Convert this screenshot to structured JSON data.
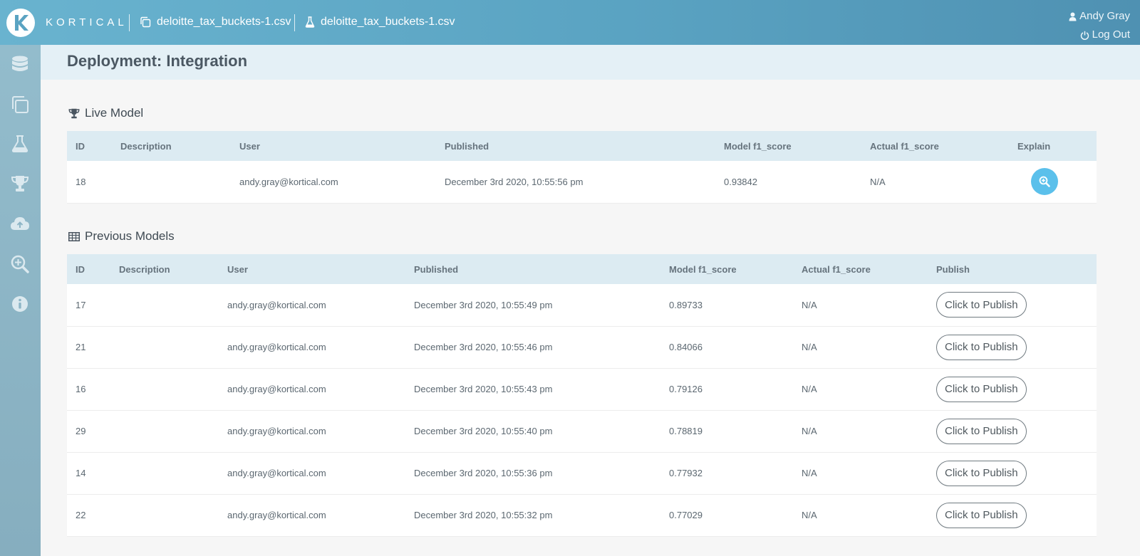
{
  "header": {
    "brand": "KORTICAL",
    "dataset_crumb": "deloitte_tax_buckets-1.csv",
    "experiment_crumb": "deloitte_tax_buckets-1.csv",
    "user_name": "Andy Gray",
    "logout_label": "Log Out"
  },
  "sidebar": {
    "items": [
      {
        "icon": "database-icon"
      },
      {
        "icon": "copy-icon"
      },
      {
        "icon": "flask-icon"
      },
      {
        "icon": "trophy-icon"
      },
      {
        "icon": "cloud-upload-icon"
      },
      {
        "icon": "zoom-in-icon"
      },
      {
        "icon": "info-icon"
      }
    ]
  },
  "page": {
    "title": "Deployment: Integration"
  },
  "live": {
    "title": "Live Model",
    "columns": [
      "ID",
      "Description",
      "User",
      "Published",
      "Model f1_score",
      "Actual f1_score",
      "Explain"
    ],
    "row": {
      "id": "18",
      "description": "",
      "user": "andy.gray@kortical.com",
      "published": "December 3rd 2020, 10:55:56 pm",
      "model_f1": "0.93842",
      "actual_f1": "N/A"
    }
  },
  "previous": {
    "title": "Previous Models",
    "columns": [
      "ID",
      "Description",
      "User",
      "Published",
      "Model f1_score",
      "Actual f1_score",
      "Publish"
    ],
    "publish_label": "Click to Publish",
    "rows": [
      {
        "id": "17",
        "description": "",
        "user": "andy.gray@kortical.com",
        "published": "December 3rd 2020, 10:55:49 pm",
        "model_f1": "0.89733",
        "actual_f1": "N/A"
      },
      {
        "id": "21",
        "description": "",
        "user": "andy.gray@kortical.com",
        "published": "December 3rd 2020, 10:55:46 pm",
        "model_f1": "0.84066",
        "actual_f1": "N/A"
      },
      {
        "id": "16",
        "description": "",
        "user": "andy.gray@kortical.com",
        "published": "December 3rd 2020, 10:55:43 pm",
        "model_f1": "0.79126",
        "actual_f1": "N/A"
      },
      {
        "id": "29",
        "description": "",
        "user": "andy.gray@kortical.com",
        "published": "December 3rd 2020, 10:55:40 pm",
        "model_f1": "0.78819",
        "actual_f1": "N/A"
      },
      {
        "id": "14",
        "description": "",
        "user": "andy.gray@kortical.com",
        "published": "December 3rd 2020, 10:55:36 pm",
        "model_f1": "0.77932",
        "actual_f1": "N/A"
      },
      {
        "id": "22",
        "description": "",
        "user": "andy.gray@kortical.com",
        "published": "December 3rd 2020, 10:55:32 pm",
        "model_f1": "0.77029",
        "actual_f1": "N/A"
      }
    ]
  },
  "colors": {
    "accent": "#5bc0eb",
    "topbar": "#5aa3c2",
    "sidebar": "#8db5c6",
    "table_header": "#dcebf2"
  }
}
